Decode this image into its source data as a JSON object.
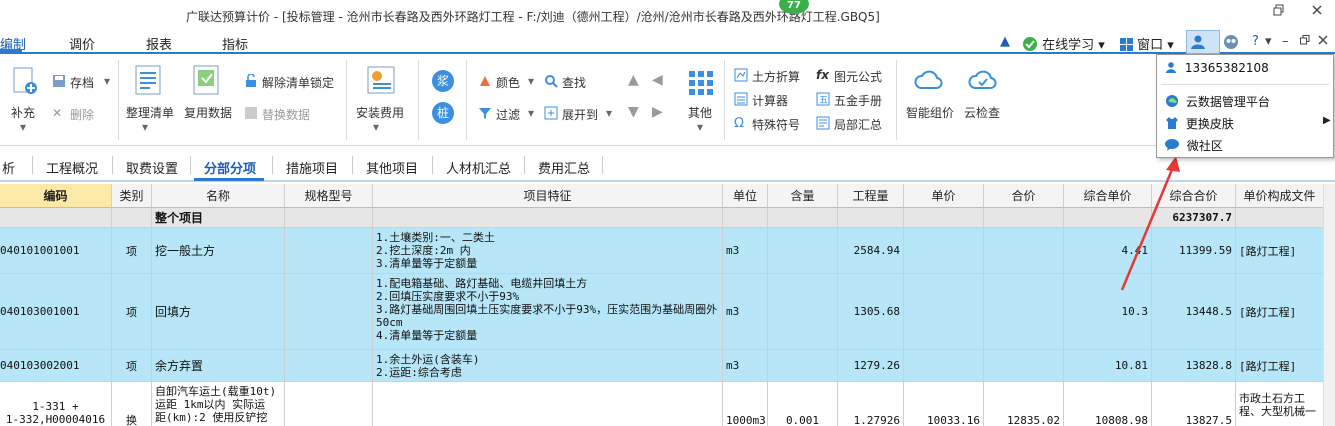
{
  "window": {
    "title": "广联达预算计价 - [投标管理 - 沧州市长春路及西外环路灯工程 - F:/刘迪（德州工程）/沧州/沧州市长春路及西外环路灯工程.GBQ5]",
    "badge": "77",
    "restore_icon": "restore-icon",
    "close_icon": "close-icon"
  },
  "menu": {
    "items": [
      "编制",
      "调价",
      "报表",
      "指标"
    ],
    "active": "编制"
  },
  "right_tools": {
    "online_learning": "在线学习",
    "window": "窗口",
    "help": "?"
  },
  "ribbon": {
    "supplement": "补充",
    "save_as": "存档",
    "delete": "删除",
    "organize_list": "整理清单",
    "reuse_data": "复用数据",
    "unlock_list": "解除清单锁定",
    "replace_data": "替换数据",
    "install_fee": "安装费用",
    "jiang": "浆",
    "zhuang": "桩",
    "color": "颜色",
    "search": "查找",
    "filter": "过滤",
    "expand_to": "展开到",
    "other": "其他",
    "earthwork_calc": "土方折算",
    "figure_formula": "图元公式",
    "calculator": "计算器",
    "hardware_manual": "五金手册",
    "special_symbol": "特殊符号",
    "partial_summary": "局部汇总",
    "smart_price": "智能组价",
    "cloud_check": "云检查"
  },
  "tabs": {
    "partial": "析",
    "items": [
      "工程概况",
      "取费设置",
      "分部分项",
      "措施项目",
      "其他项目",
      "人材机汇总",
      "费用汇总"
    ],
    "active": "分部分项"
  },
  "table": {
    "headers": [
      "编码",
      "类别",
      "名称",
      "规格型号",
      "项目特征",
      "单位",
      "含量",
      "工程量",
      "单价",
      "合价",
      "综合单价",
      "综合合价",
      "单价构成文件"
    ],
    "rows": [
      {
        "code": "",
        "type": "",
        "name": "整个项目",
        "spec": "",
        "features": "",
        "unit": "",
        "content": "",
        "qty": "",
        "price": "",
        "total": "",
        "unit_comp": "",
        "total_comp": "6237307.7",
        "file": ""
      },
      {
        "code": "040101001001",
        "type": "项",
        "name": "挖一般土方",
        "spec": "",
        "features": "1.土壤类别:一、二类土\n2.挖土深度:2m 内\n3.清单量等于定额量",
        "unit": "m3",
        "content": "",
        "qty": "2584.94",
        "price": "",
        "total": "",
        "unit_comp": "4.41",
        "total_comp": "11399.59",
        "file": "[路灯工程]"
      },
      {
        "code": "040103001001",
        "type": "项",
        "name": "回填方",
        "spec": "",
        "features": "1.配电箱基础、路灯基础、电缆井回填土方\n2.回填压实度要求不小于93%\n3.路灯基础周围回填土压实度要求不小于93%，压实范围为基础周圈外50cm\n4.清单量等于定额量",
        "unit": "m3",
        "content": "",
        "qty": "1305.68",
        "price": "",
        "total": "",
        "unit_comp": "10.3",
        "total_comp": "13448.5",
        "file": "[路灯工程]"
      },
      {
        "code": "040103002001",
        "type": "项",
        "name": "余方弃置",
        "spec": "",
        "features": "1.余土外运(含装车)\n2.运距:综合考虑",
        "unit": "m3",
        "content": "",
        "qty": "1279.26",
        "price": "",
        "total": "",
        "unit_comp": "10.81",
        "total_comp": "13828.8",
        "file": "[路灯工程]"
      },
      {
        "code": "1-331 +\n1-332,H00004016",
        "type": "换",
        "name": "自卸汽车运土(载重10t)\n运距 1km以内  实际运\n距(km):2  使用反铲挖",
        "spec": "",
        "features": "",
        "unit": "1000m3",
        "content": "0.001",
        "qty": "1.27926",
        "price": "10033.16",
        "total": "12835.02",
        "unit_comp": "10808.98",
        "total_comp": "13827.5",
        "file": "市政土石方工\n程、大型机械一"
      }
    ]
  },
  "dropdown": {
    "items": [
      "13365382108",
      "云数据管理平台",
      "更换皮肤",
      "微社区"
    ]
  },
  "colors": {
    "accent": "#2b7bd0",
    "selected_row": "#b6e6f7",
    "code_header": "#fbe9a8",
    "annotation_arrow": "#e53935"
  }
}
